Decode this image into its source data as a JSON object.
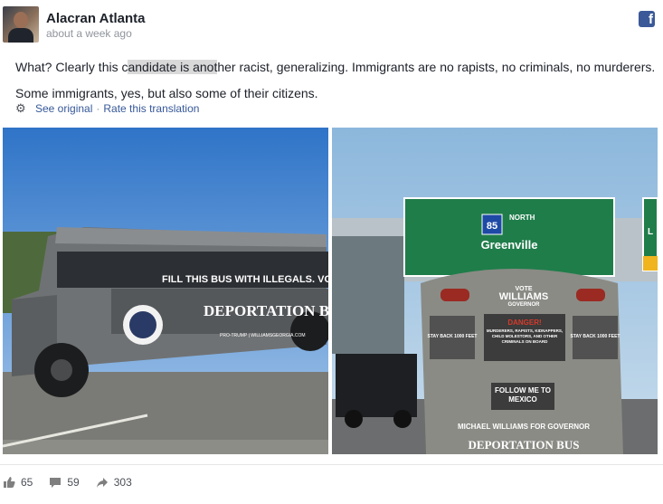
{
  "post": {
    "author": "Alacran Atlanta",
    "time": "about a week ago",
    "text_before": "What? Clearly this c",
    "text_highlight": "andidate is anot",
    "text_after": "her racist, generalizing. Immigrants are no rapists, no criminals, no murderers. Some immigrants, yes, but also some of their citizens.",
    "see_original": "See original",
    "separator": "·",
    "rate_translation": "Rate this translation"
  },
  "photo_left": {
    "sign_fill": "FILL THIS BUS WITH ILLEGALS. VOTE",
    "sign_deport": "DEPORTATION BUS",
    "sign_small": "PRO-TRUMP | WILLIAMSGEORGIA.COM"
  },
  "photo_right": {
    "highway_route": "85",
    "highway_direction": "NORTH",
    "highway_city": "Greenville",
    "side_sign_letter": "L",
    "bus_vote": "VOTE",
    "bus_williams": "WILLIAMS",
    "bus_governor": "GOVERNOR",
    "stay_back_left": "STAY BACK 1000 FEET",
    "stay_back_right": "STAY BACK 1000 FEET",
    "danger": "DANGER!",
    "danger_text": "MURDERERS, RAPISTS, KIDNAPPERS, CHILD MOLESTORS, AND OTHER CRIMINALS ON BOARD",
    "follow_me": "FOLLOW ME TO MEXICO",
    "michael": "MICHAEL WILLIAMS FOR GOVERNOR",
    "deport": "DEPORTATION BUS"
  },
  "stats": {
    "likes": "65",
    "comments": "59",
    "shares": "303"
  },
  "colors": {
    "link": "#365899",
    "facebook": "#3b5998",
    "highway_green": "#1f7d4a"
  }
}
